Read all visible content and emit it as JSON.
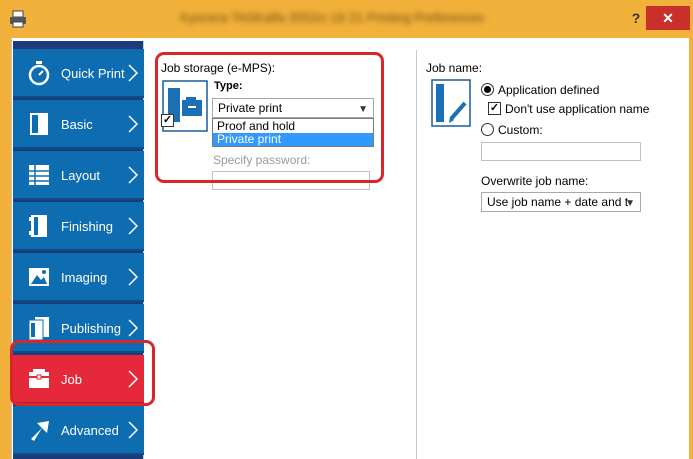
{
  "window": {
    "title": "Kyocera TASKalfa 3552ci 19 21 Printing Preferences",
    "help_label": "?",
    "close_label": "✕",
    "accent": "#f2b13a",
    "close_color": "#c9302c"
  },
  "sidebar": {
    "items": [
      {
        "label": "Quick Print",
        "icon": "stopwatch-icon"
      },
      {
        "label": "Basic",
        "icon": "page-icon"
      },
      {
        "label": "Layout",
        "icon": "layout-grid-icon"
      },
      {
        "label": "Finishing",
        "icon": "finishing-icon"
      },
      {
        "label": "Imaging",
        "icon": "image-icon"
      },
      {
        "label": "Publishing",
        "icon": "publishing-icon"
      },
      {
        "label": "Job",
        "icon": "job-folder-icon",
        "active": true
      },
      {
        "label": "Advanced",
        "icon": "arrow-icon"
      }
    ],
    "bg_color": "#0e6db1",
    "active_color": "#e5293a"
  },
  "job_storage": {
    "title": "Job storage (e-MPS):",
    "enabled": true,
    "type_label": "Type:",
    "type_value": "Private print",
    "options": [
      "Proof and hold",
      "Private print"
    ],
    "selected_option": "Private print",
    "password_label": "Specify password:",
    "password_value": ""
  },
  "job_name": {
    "title": "Job name:",
    "application_defined_label": "Application defined",
    "application_defined_selected": true,
    "dont_use_app_name_label": "Don't use application name",
    "dont_use_app_name_checked": true,
    "custom_label": "Custom:",
    "custom_value": "",
    "overwrite_label": "Overwrite job name:",
    "overwrite_value": "Use job name + date and t"
  },
  "highlight_color": "#d8262b"
}
